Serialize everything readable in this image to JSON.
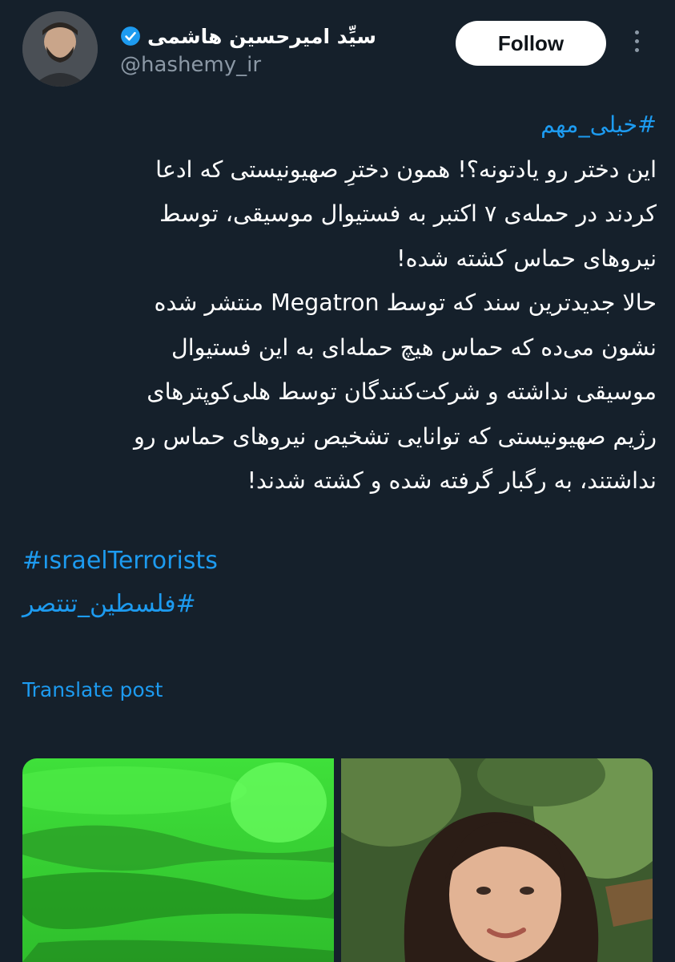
{
  "author": {
    "display_name": "سیِّد امیرحسین هاشمی",
    "handle": "@hashemy_ir",
    "verified_icon": "verified-badge-icon",
    "avatar": "avatar-photo"
  },
  "actions": {
    "follow_label": "Follow",
    "more_icon": "more-vertical-icon"
  },
  "post": {
    "hashtag_top": "#خیلی_مهم",
    "line1": "این دختر رو یادتونه؟! همون دخترِ صهیونیستی که ادعا",
    "line2": "کردند در حمله‌ی ۷ اکتبر به فستیوال موسیقی، توسط",
    "line3": "نیروهای حماس کشته شده!",
    "line4": "حالا جدیدترین سند که توسط Megatron منتشر شده",
    "line5": "نشون می‌ده که حماس هیچ حمله‌ای به این فستیوال",
    "line6": "موسیقی نداشته و شرکت‌کنندگان توسط هلی‌کوپترهای",
    "line7": "رژیم صهیونیستی که توانایی تشخیص نیروهای حماس رو",
    "line8": "نداشتند، به رگبار گرفته شده و کشته شدند!",
    "hashtag_en": "#ısraelTerrorists",
    "hashtag_fa": "#فلسطین_تنتصر",
    "translate_label": "Translate post"
  },
  "media": {
    "left_description_icon": "green-night-vision-image",
    "right_description_icon": "woman-portrait-image"
  },
  "colors": {
    "background": "#15202b",
    "link": "#1d9bf0",
    "muted": "#8b98a5",
    "text": "#ffffff"
  }
}
